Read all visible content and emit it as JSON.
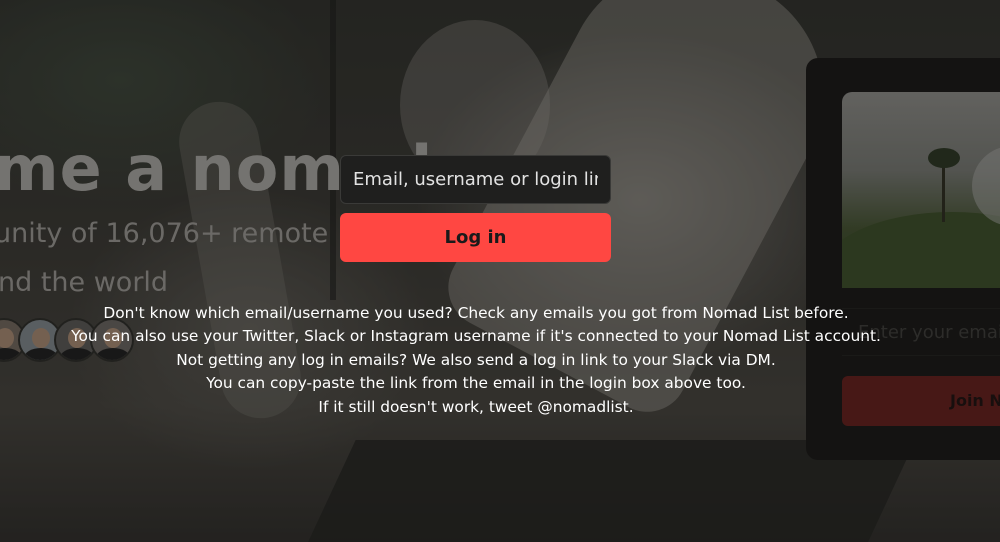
{
  "background": {
    "hero_title": "me a nomad",
    "hero_subtitle": "unity of 16,076+ remote",
    "hero_subtitle2": "nd the world",
    "signup_card": {
      "email_placeholder": "Enter your email",
      "join_label": "Join N"
    }
  },
  "login": {
    "input_placeholder": "Email, username or login link",
    "button_label": "Log in"
  },
  "help": {
    "lines": [
      "Don't know which email/username you used? Check any emails you got from Nomad List before.",
      "You can also use your Twitter, Slack or Instagram username if it's connected to your Nomad List account.",
      "Not getting any log in emails? We also send a log in link to your Slack via DM.",
      "You can copy-paste the link from the email in the login box above too.",
      "If it still doesn't work, tweet @nomadlist."
    ]
  },
  "colors": {
    "accent": "#ff4742",
    "overlay": "#000000",
    "input_background": "#1f1f1e"
  }
}
